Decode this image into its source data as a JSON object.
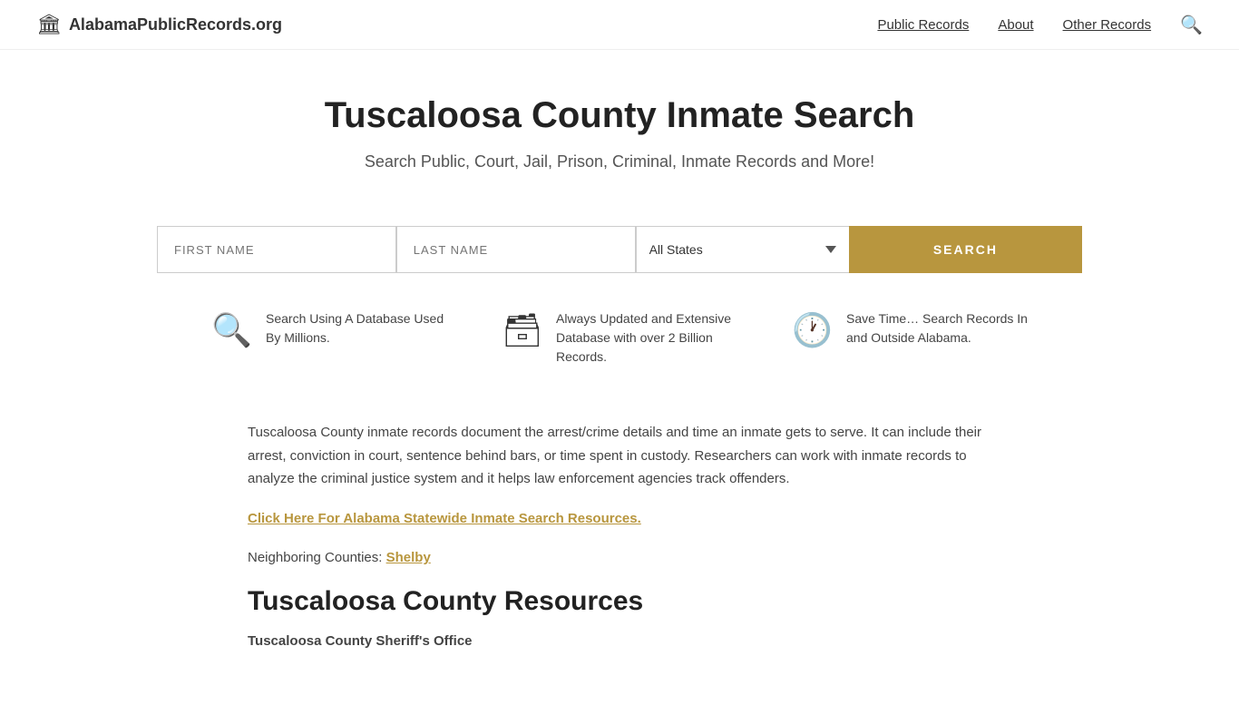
{
  "header": {
    "logo_icon": "🏛",
    "logo_text": "AlabamaPublicRecords.org",
    "nav": [
      {
        "label": "Public Records",
        "href": "#"
      },
      {
        "label": "About",
        "href": "#"
      },
      {
        "label": "Other Records",
        "href": "#"
      }
    ]
  },
  "hero": {
    "title": "Tuscaloosa County Inmate Search",
    "subtitle": "Search Public, Court, Jail, Prison, Criminal, Inmate Records and More!"
  },
  "search": {
    "first_name_placeholder": "FIRST NAME",
    "last_name_placeholder": "LAST NAME",
    "state_default": "All States",
    "button_label": "SEARCH"
  },
  "features": [
    {
      "icon_name": "search-feature-icon",
      "icon_char": "🔍",
      "text": "Search Using A Database Used By Millions."
    },
    {
      "icon_name": "database-feature-icon",
      "icon_char": "🗄",
      "text": "Always Updated and Extensive Database with over 2 Billion Records."
    },
    {
      "icon_name": "clock-feature-icon",
      "icon_char": "🕐",
      "text": "Save Time… Search Records In and Outside Alabama."
    }
  ],
  "body": {
    "description": "Tuscaloosa County inmate records document the arrest/crime details and time an inmate gets to serve. It can include their arrest, conviction in court, sentence behind bars, or time spent in custody. Researchers can work with inmate records to analyze the criminal justice system and it helps law enforcement agencies track offenders.",
    "statewide_link_text": "Click Here For Alabama Statewide Inmate Search Resources.",
    "neighboring_label": "Neighboring Counties:",
    "neighboring_counties": [
      {
        "name": "Shelby",
        "href": "#"
      }
    ],
    "resources_title": "Tuscaloosa County Resources",
    "sheriff_title": "Tuscaloosa County Sheriff's Office"
  }
}
